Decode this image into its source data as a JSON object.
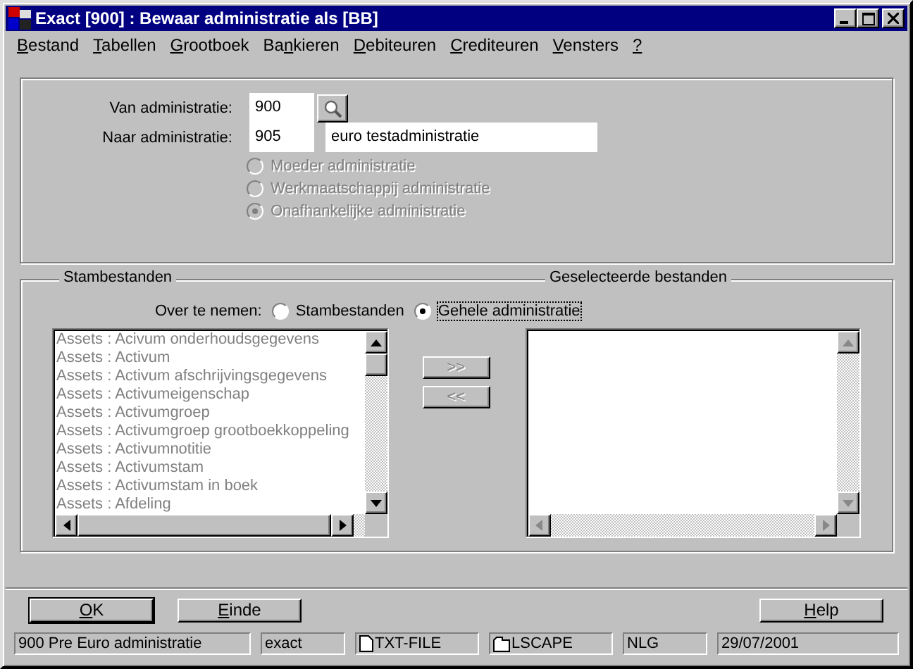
{
  "window": {
    "title": "Exact [900] : Bewaar administratie als [BB]"
  },
  "menu": [
    "Bestand",
    "Tabellen",
    "Grootboek",
    "Bankieren",
    "Debiteuren",
    "Crediteuren",
    "Vensters",
    "?"
  ],
  "admin": {
    "from_label": "Van administratie:",
    "from_value": "900",
    "to_label": "Naar administratie:",
    "to_value": "905",
    "to_name": "euro testadministratie",
    "types": [
      {
        "label": "Moeder administratie",
        "selected": false,
        "disabled": true
      },
      {
        "label": "Werkmaatschappij administratie",
        "selected": false,
        "disabled": true
      },
      {
        "label": "Onafhankelijke administratie",
        "selected": true,
        "disabled": true
      }
    ]
  },
  "transfer": {
    "left_title": "Stambestanden",
    "right_title": "Geselecteerde bestanden",
    "mode_label": "Over te nemen:",
    "modes": [
      {
        "label": "Stambestanden",
        "selected": false
      },
      {
        "label": "Gehele administratie",
        "selected": true
      }
    ],
    "available": [
      "Assets : Acivum onderhoudsgegevens",
      "Assets : Activum",
      "Assets : Activum afschrijvingsgegevens",
      "Assets : Activumeigenschap",
      "Assets : Activumgroep",
      "Assets : Activumgroep grootboekkoppeling",
      "Assets : Activumnotitie",
      "Assets : Activumstam",
      "Assets : Activumstam in boek",
      "Assets : Afdeling"
    ],
    "add_button": ">>",
    "remove_button": "<<",
    "lists_disabled": true
  },
  "buttons": [
    "OK",
    "Einde",
    "Help"
  ],
  "status_bar": [
    "900 Pre Euro administratie",
    "exact",
    "TXT-FILE",
    "LSCAPE",
    "NLG",
    "29/07/2001"
  ]
}
